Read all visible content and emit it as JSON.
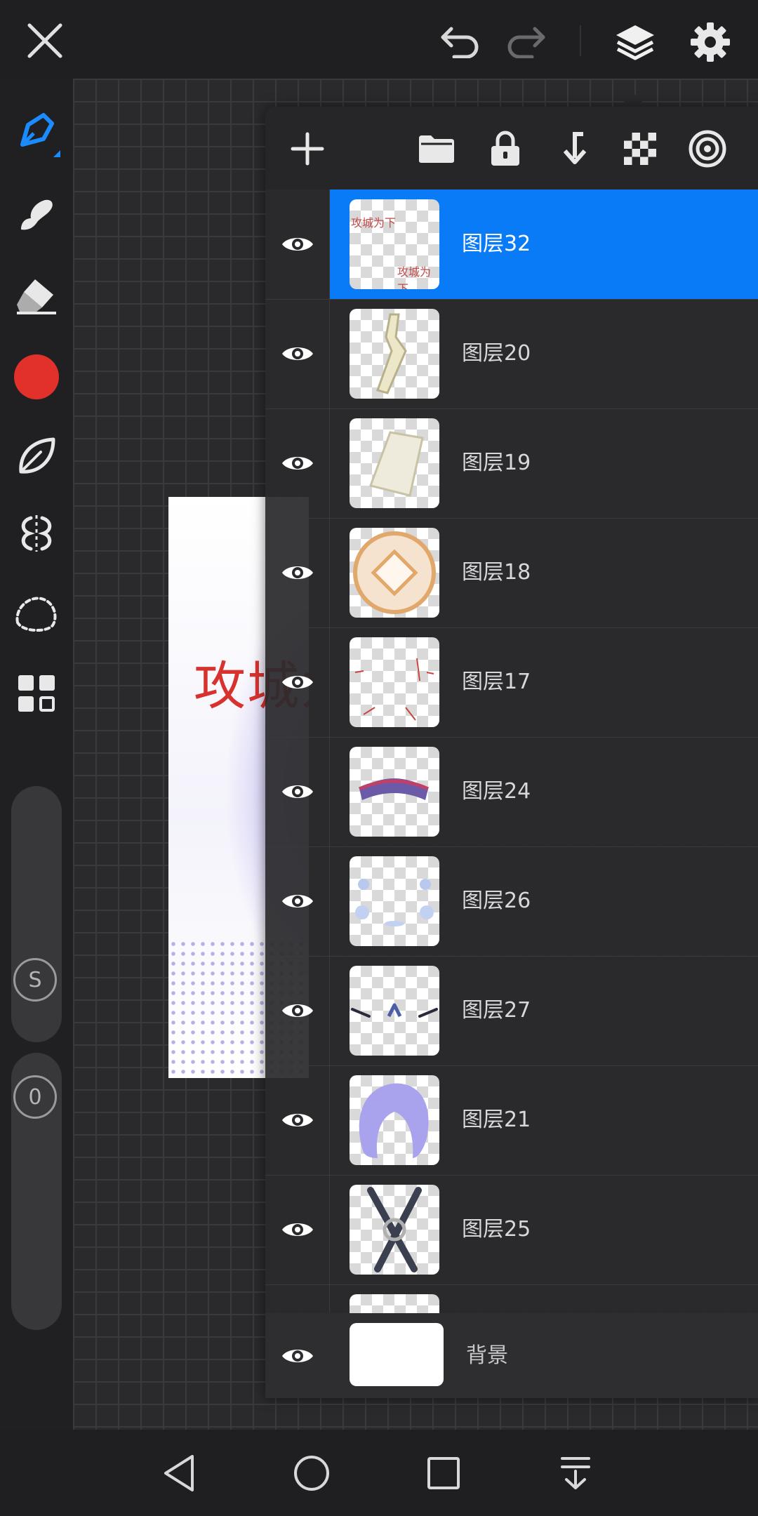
{
  "layers": [
    {
      "name": "图层32",
      "selected": true,
      "visible": true
    },
    {
      "name": "图层20",
      "selected": false,
      "visible": true
    },
    {
      "name": "图层19",
      "selected": false,
      "visible": true
    },
    {
      "name": "图层18",
      "selected": false,
      "visible": true
    },
    {
      "name": "图层17",
      "selected": false,
      "visible": true
    },
    {
      "name": "图层24",
      "selected": false,
      "visible": true
    },
    {
      "name": "图层26",
      "selected": false,
      "visible": true
    },
    {
      "name": "图层27",
      "selected": false,
      "visible": true
    },
    {
      "name": "图层21",
      "selected": false,
      "visible": true
    },
    {
      "name": "图层25",
      "selected": false,
      "visible": true
    }
  ],
  "background_layer": {
    "name": "背景",
    "visible": true
  },
  "artwork_text": "攻城为",
  "thumb32_text": "攻城为下",
  "size_badge": "S",
  "opacity_badge": "0",
  "colors": {
    "accent": "#0a7bf7",
    "current_color": "#e2302a",
    "pen_accent": "#1a8cff"
  },
  "icons": {
    "top": [
      "close-icon",
      "undo-icon",
      "redo-icon",
      "layers-icon",
      "settings-icon"
    ],
    "panel": [
      "add-layer-icon",
      "folder-icon",
      "lock-icon",
      "merge-down-icon",
      "alpha-lock-icon",
      "clipping-icon"
    ],
    "nav": [
      "back-icon",
      "home-icon",
      "recents-icon",
      "notification-icon"
    ]
  }
}
